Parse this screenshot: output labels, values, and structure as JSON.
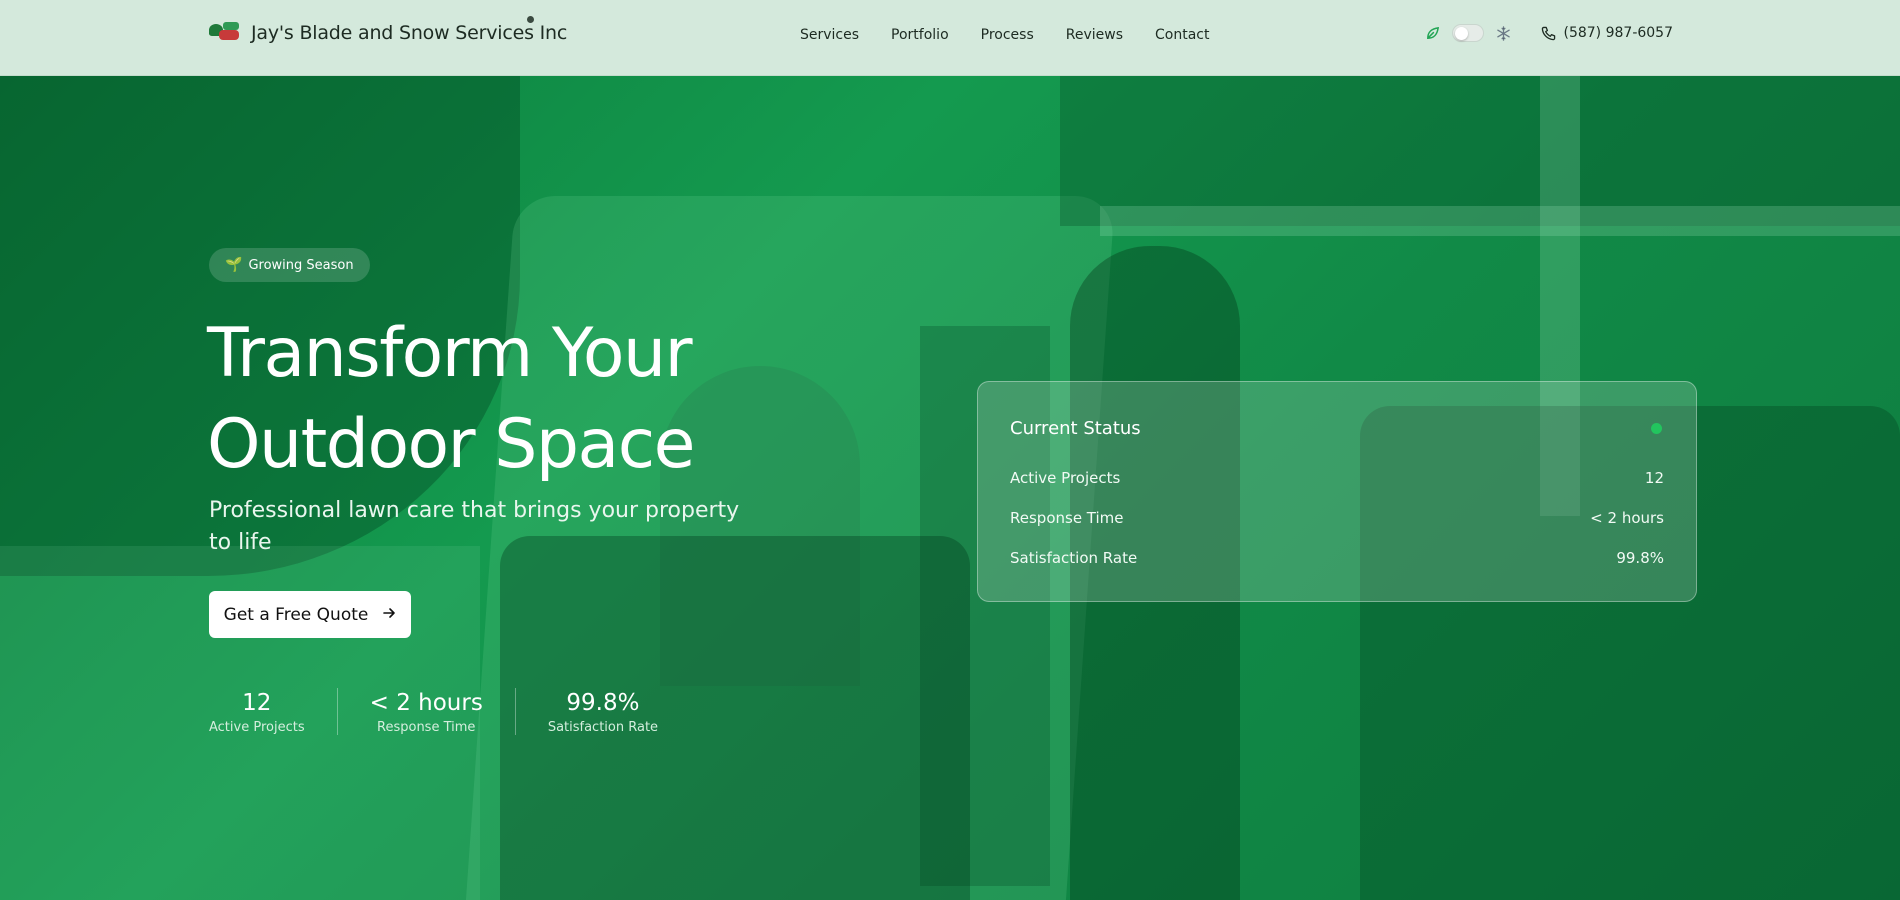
{
  "brand": {
    "name": "Jay's Blade and Snow Services Inc"
  },
  "nav": {
    "items": [
      "Services",
      "Portfolio",
      "Process",
      "Reviews",
      "Contact"
    ]
  },
  "header": {
    "phone": "(587) 987-6057",
    "mode_icons": {
      "left": "leaf-icon",
      "right": "snowflake-icon"
    },
    "season_toggle_on": false
  },
  "hero": {
    "badge": "Growing Season",
    "title_line1": "Transform Your",
    "title_line2": "Outdoor Space",
    "subtitle": "Professional lawn care that brings your property to life",
    "cta": "Get a Free Quote",
    "stats": [
      {
        "value": "12",
        "label": "Active Projects"
      },
      {
        "value": "< 2 hours",
        "label": "Response Time"
      },
      {
        "value": "99.8%",
        "label": "Satisfaction Rate"
      }
    ]
  },
  "status_card": {
    "title": "Current Status",
    "rows": [
      {
        "label": "Active Projects",
        "value": "12"
      },
      {
        "label": "Response Time",
        "value": "< 2 hours"
      },
      {
        "label": "Satisfaction Rate",
        "value": "99.8%"
      }
    ]
  },
  "colors": {
    "accent": "#22c55e",
    "header_bg": "#d4e9dc",
    "hero_green": "#149a4f"
  }
}
